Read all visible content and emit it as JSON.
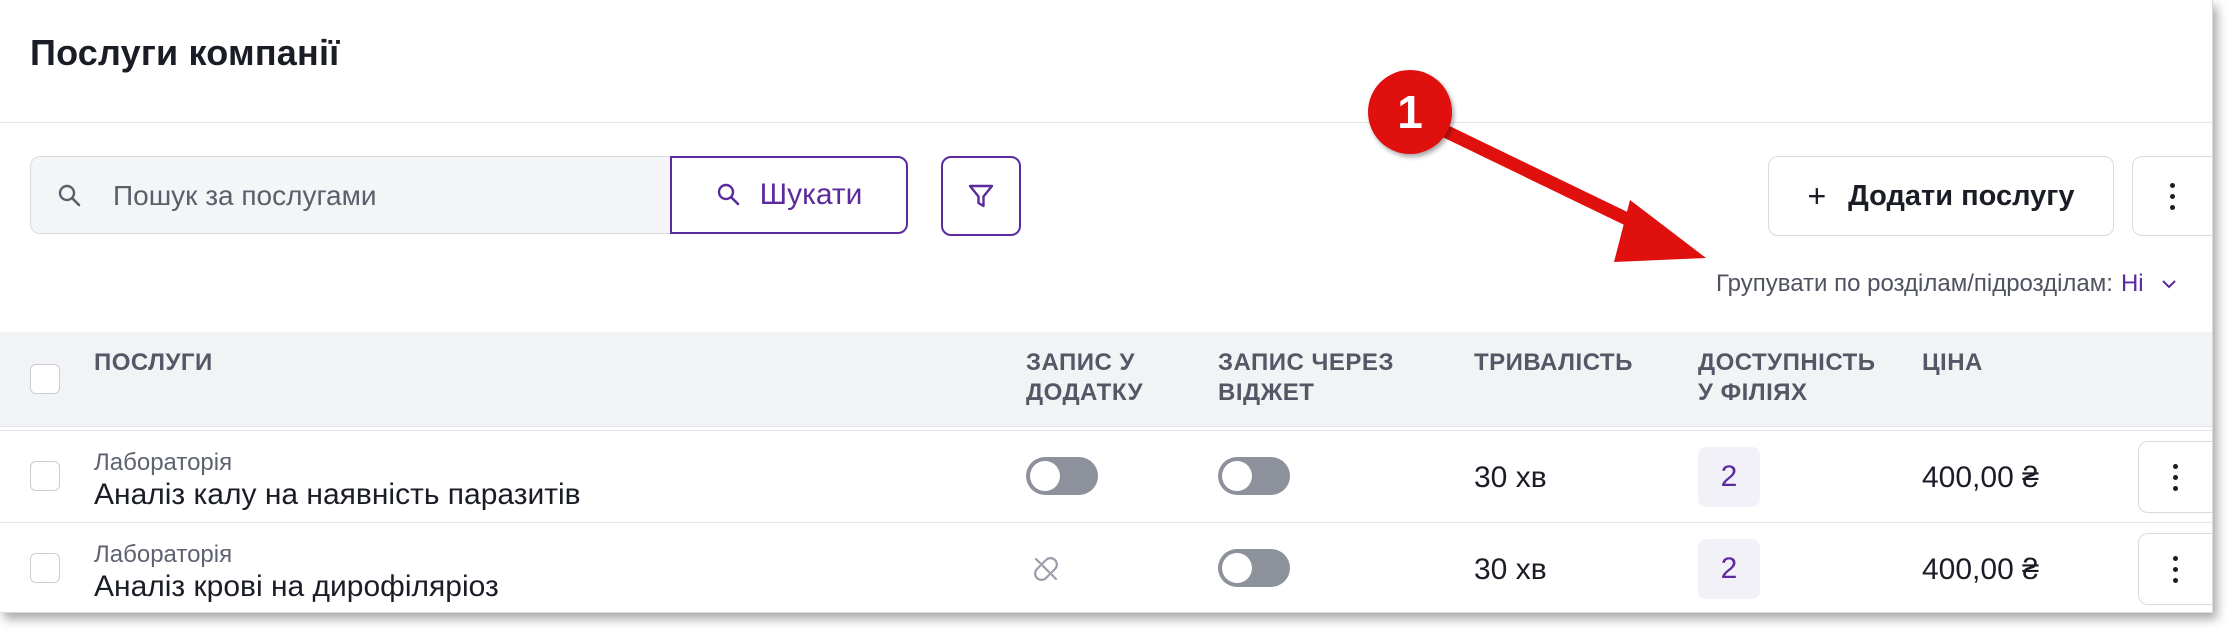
{
  "page": {
    "title": "Послуги компанії"
  },
  "toolbar": {
    "search_placeholder": "Пошук за послугами",
    "search_button": "Шукати",
    "add_button": "Додати послугу"
  },
  "grouping": {
    "label": "Групувати по розділам/підрозділам:",
    "value": "Ні"
  },
  "table": {
    "columns": {
      "services": "Послуги",
      "app_booking_1": "Запис у",
      "app_booking_2": "додатку",
      "widget_booking_1": "Запис через",
      "widget_booking_2": "віджет",
      "duration": "Тривалість",
      "availability_1": "Доступність",
      "availability_2": "у філіях",
      "price": "Ціна"
    },
    "rows": [
      {
        "category": "Лабораторія",
        "name": "Аналіз калу на наявність паразитів",
        "app_booking": "off",
        "widget_booking": "off",
        "duration": "30 хв",
        "branches": "2",
        "price": "400,00 ₴"
      },
      {
        "category": "Лабораторія",
        "name": "Аналіз крові на дирофіляріоз",
        "app_booking": "unlinked",
        "widget_booking": "off",
        "duration": "30 хв",
        "branches": "2",
        "price": "400,00 ₴"
      }
    ]
  },
  "annotation": {
    "badge": "1",
    "color": "#e0100f"
  },
  "colors": {
    "accent": "#5b2a9c",
    "header_bg": "#f2f3f5",
    "toggle_off": "#8d919b"
  },
  "icons": [
    "search-icon",
    "filter-icon",
    "plus-icon",
    "kebab-icon",
    "chevron-down-icon",
    "link-off-icon"
  ]
}
